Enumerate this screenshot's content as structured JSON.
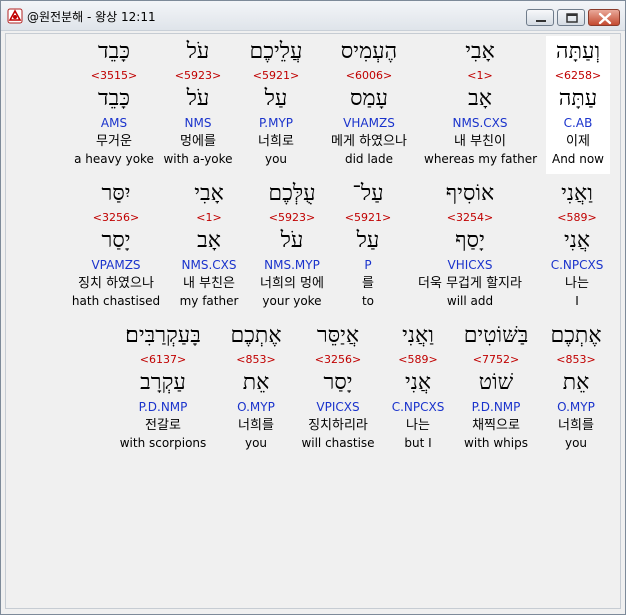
{
  "window": {
    "title": "@원전분해 - 왕상 12:11",
    "app_icon": "app-icon",
    "minimize_icon": "minimize-icon",
    "maximize_icon": "maximize-icon",
    "close_icon": "close-icon",
    "close_color": "#c44a30"
  },
  "colors": {
    "strong_number": "#c00000",
    "parsing": "#1a33cc",
    "text": "#000000"
  },
  "rows": [
    {
      "words": [
        {
          "heb": "וְעַתָּה",
          "strong": "<6258>",
          "lemma": "עַתָּה",
          "parse": "C.AB",
          "ko": "이제",
          "en": "And now",
          "selected": true
        },
        {
          "heb": "אָבִי",
          "strong": "<1>",
          "lemma": "אָב",
          "parse": "NMS.CXS",
          "ko": "내 부친이",
          "en": "whereas my father",
          "selected": false
        },
        {
          "heb": "הֶעְמִיס",
          "strong": "<6006>",
          "lemma": "עָמַס",
          "parse": "VHAMZS",
          "ko": "메게 하였으나",
          "en": "did lade",
          "selected": false
        },
        {
          "heb": "עֲלֵיכֶם",
          "strong": "<5921>",
          "lemma": "עַל",
          "parse": "P.MYP",
          "ko": "너희로",
          "en": "you",
          "selected": false
        },
        {
          "heb": "עֹל",
          "strong": "<5923>",
          "lemma": "עֹל",
          "parse": "NMS",
          "ko": "멍에를",
          "en": "with a-yoke",
          "selected": false
        },
        {
          "heb": "כָּבֵד",
          "strong": "<3515>",
          "lemma": "כָּבֵד",
          "parse": "AMS",
          "ko": "무거운",
          "en": "a heavy yoke",
          "selected": false
        }
      ]
    },
    {
      "words": [
        {
          "heb": "וַאֲנִי",
          "strong": "<589>",
          "lemma": "אֲנִי",
          "parse": "C.NPCXS",
          "ko": "나는",
          "en": "I",
          "selected": false
        },
        {
          "heb": "אוֹסִיף",
          "strong": "<3254>",
          "lemma": "יָסַף",
          "parse": "VHICXS",
          "ko": "더욱 무겁게 할지라",
          "en": "will add",
          "selected": false
        },
        {
          "heb": "עַל־",
          "strong": "<5921>",
          "lemma": "עַל",
          "parse": "P",
          "ko": "를",
          "en": "to",
          "selected": false
        },
        {
          "heb": "עֻלְּכֶם",
          "strong": "<5923>",
          "lemma": "עֹל",
          "parse": "NMS.MYP",
          "ko": "너희의 멍에",
          "en": "your yoke",
          "selected": false
        },
        {
          "heb": "אָבִי",
          "strong": "<1>",
          "lemma": "אָב",
          "parse": "NMS.CXS",
          "ko": "내 부친은",
          "en": "my father",
          "selected": false
        },
        {
          "heb": "יִסַּר",
          "strong": "<3256>",
          "lemma": "יָסַר",
          "parse": "VPAMZS",
          "ko": "징치 하였으나",
          "en": "hath chastised",
          "selected": false
        }
      ]
    },
    {
      "words": [
        {
          "heb": "אֶתְכֶם",
          "strong": "<853>",
          "lemma": "אֵת",
          "parse": "O.MYP",
          "ko": "너희를",
          "en": "you",
          "selected": false
        },
        {
          "heb": "בַּשּׁוֹטִים",
          "strong": "<7752>",
          "lemma": "שׁוֹט",
          "parse": "P.D.NMP",
          "ko": "채찍으로",
          "en": "with whips",
          "selected": false
        },
        {
          "heb": "וַאֲנִי",
          "strong": "<589>",
          "lemma": "אֲנִי",
          "parse": "C.NPCXS",
          "ko": "나는",
          "en": "but I",
          "selected": false
        },
        {
          "heb": "אֲיַסֵּר",
          "strong": "<3256>",
          "lemma": "יָסַר",
          "parse": "VPICXS",
          "ko": "징치하리라",
          "en": "will chastise",
          "selected": false
        },
        {
          "heb": "אֶתְכֶם",
          "strong": "<853>",
          "lemma": "אֵת",
          "parse": "O.MYP",
          "ko": "너희를",
          "en": "you",
          "selected": false
        },
        {
          "heb": "בָּעַקְרַבִּים׃",
          "strong": "<6137>",
          "lemma": "עַקְרָב",
          "parse": "P.D.NMP",
          "ko": "전갈로",
          "en": "with scorpions",
          "selected": false
        }
      ]
    }
  ]
}
